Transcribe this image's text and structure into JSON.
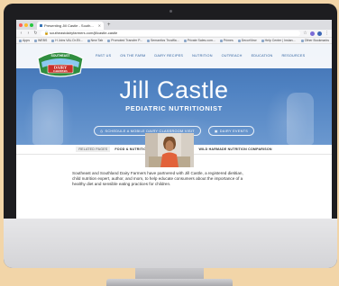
{
  "browser": {
    "tab_title": "Presenting Jill Castle - South...",
    "url": "southeastdairyfarmers.com/jillcastle-castle",
    "bookmarks": [
      "Apps",
      "WEBS",
      "H Jobs  VAL Dr.Eli...",
      "New Tab",
      "Promoted Transfer P...",
      "Semantics Trustfla...",
      "Private Sales.com...",
      "Primes",
      "DecorView",
      "Help Center | Instan..."
    ],
    "other_bookmarks": "Other Bookmarks"
  },
  "site": {
    "logo_text_top": "SOUTHEAST",
    "logo_text_main": "DAIRY",
    "logo_text_sub": "FARMERS",
    "nav": [
      "PAST US",
      "ON THE FARM",
      "DAIRY RECIPES",
      "NUTRITION",
      "OUTREACH",
      "EDUCATION",
      "RESOURCES"
    ],
    "hero_title": "Jill Castle",
    "hero_subtitle": "PEDIATRIC NUTRITIONIST",
    "button_1": "SCHEDULE A MOBILE DAIRY CLASSROOM VISIT",
    "button_2": "DAIRY EVENTS",
    "related_label": "RELATED PAGES",
    "related_links": [
      "FOOD & NUTRITION",
      "KID'S NUTRITION",
      "WILD HARMADE NUTRITION COMPARISON"
    ],
    "body_text": "Southeast and Southland Dairy Farmers have partnered with Jill Castle, a registered dietitian, child nutrition expert, author, and mom, to help educate consumers about the importance of a healthy diet and sensible eating practices for children."
  },
  "colors": {
    "page_background": "#f2d5a8",
    "hero_blue": "#4f82c2",
    "nav_blue": "#2c5f9e",
    "logo_red": "#c8312b"
  }
}
